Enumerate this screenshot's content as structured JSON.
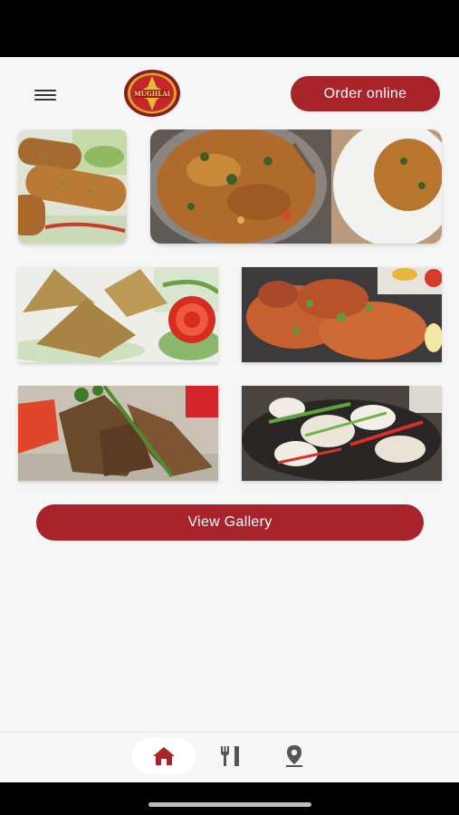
{
  "status_bar": {},
  "header": {
    "logo_text": "MUGHLAI",
    "order_label": "Order online"
  },
  "gallery": {
    "photos": [
      {
        "name": "seekh-kebab-photo"
      },
      {
        "name": "biryani-photo"
      },
      {
        "name": "samosa-photo"
      },
      {
        "name": "tandoori-chicken-photo"
      },
      {
        "name": "lamb-chops-photo"
      },
      {
        "name": "chicken-tikka-sizzler-photo"
      }
    ],
    "view_label": "View Gallery"
  },
  "bottom_nav": {
    "items": [
      {
        "icon": "home-icon",
        "active": true
      },
      {
        "icon": "cutlery-icon",
        "active": false
      },
      {
        "icon": "location-pin-icon",
        "active": false
      }
    ]
  },
  "colors": {
    "brand_red": "#a8232a",
    "background": "#f6f6f6",
    "icon_gray": "#555555"
  }
}
